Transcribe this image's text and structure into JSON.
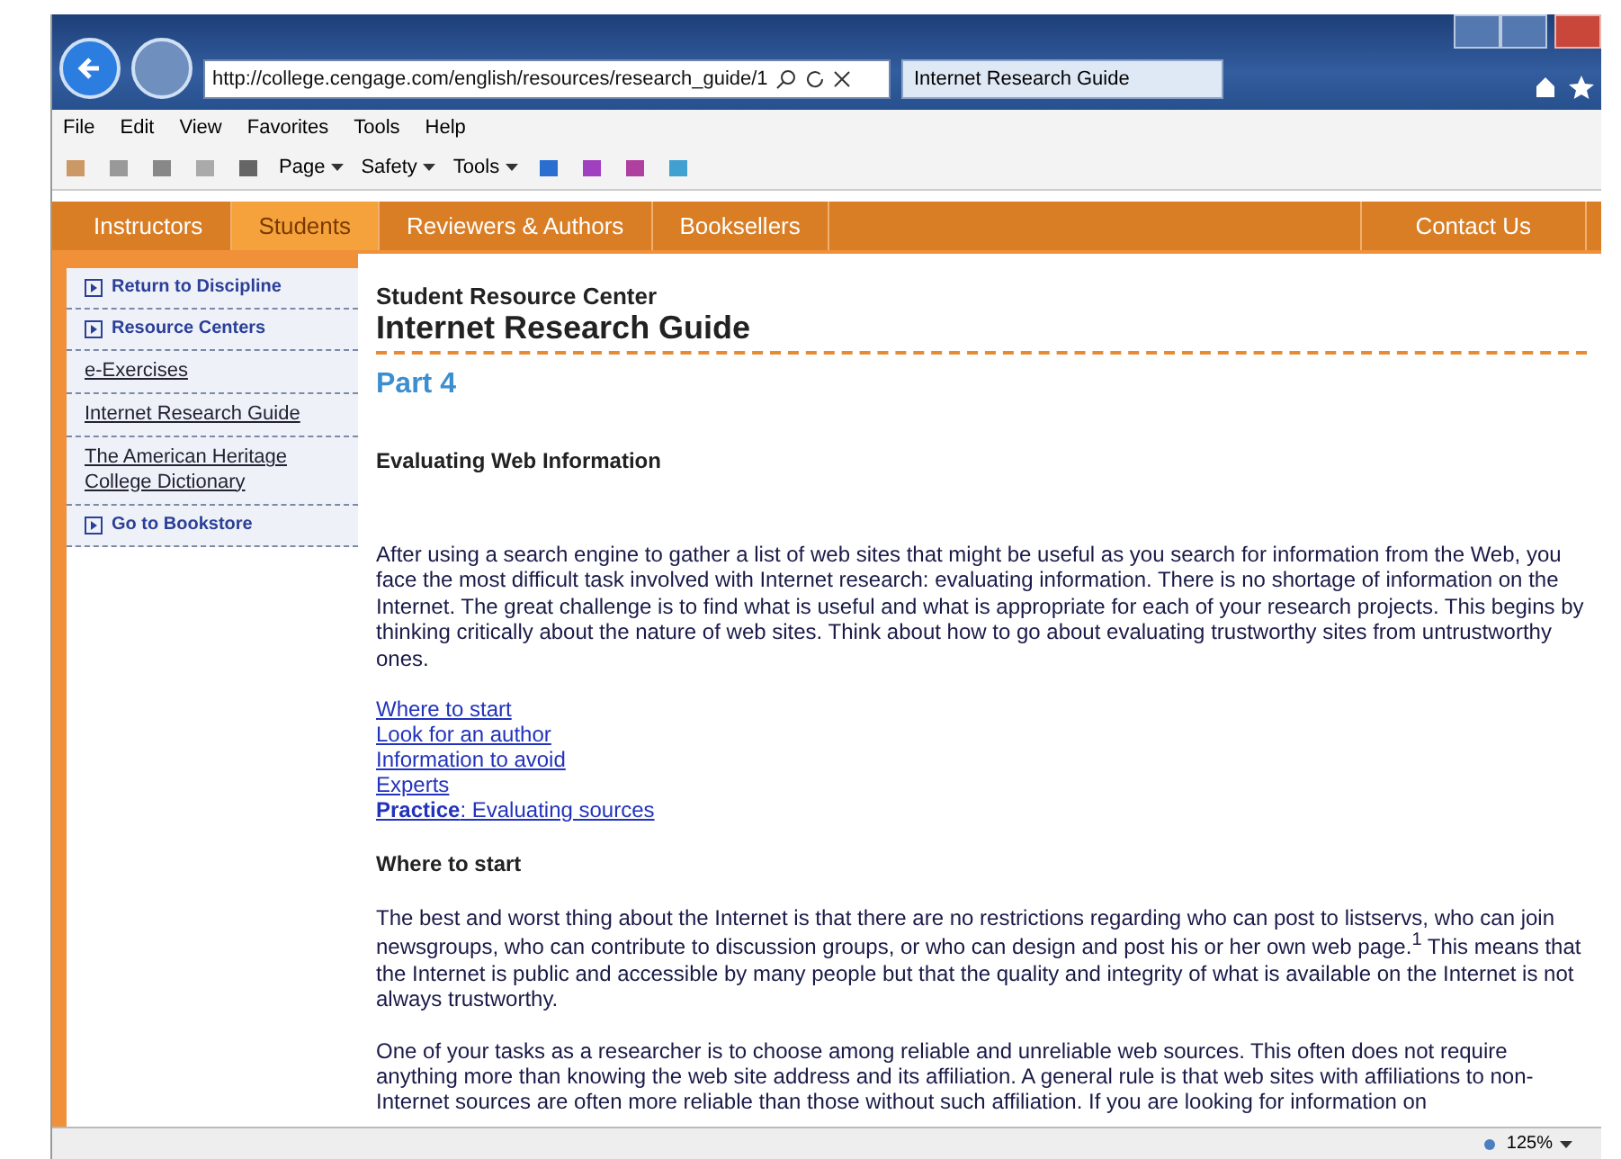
{
  "browser": {
    "address": "http://college.cengage.com/english/resources/research_guide/1",
    "tab_title": "Internet Research Guide",
    "menu": [
      "File",
      "Edit",
      "View",
      "Favorites",
      "Tools",
      "Help"
    ],
    "commands": [
      "Page",
      "Safety",
      "Tools"
    ],
    "zoom": "125%"
  },
  "nav": [
    {
      "label": "Instructors",
      "selected": false
    },
    {
      "label": "Students",
      "selected": true
    },
    {
      "label": "Reviewers & Authors",
      "selected": false
    },
    {
      "label": "Booksellers",
      "selected": false
    }
  ],
  "nav_right": "Contact Us",
  "sidebar": [
    {
      "label": "Return to Discipline",
      "kind": "section"
    },
    {
      "label": "Resource Centers",
      "kind": "section"
    },
    {
      "label": "e-Exercises",
      "kind": "link"
    },
    {
      "label": "Internet Research Guide",
      "kind": "link"
    },
    {
      "label": "The American Heritage College Dictionary",
      "kind": "link"
    },
    {
      "label": "Go to Bookstore",
      "kind": "section"
    }
  ],
  "content": {
    "kicker": "Student Resource Center",
    "title": "Internet Research Guide",
    "part": "Part 4",
    "heading": "Evaluating Web Information",
    "intro": "After using a search engine to gather a list of web sites that might be useful as you search for information from the Web, you face the most difficult task involved with Internet research: evaluating information. There is no shortage of information on the Internet. The great challenge is to find what is useful and what is appropriate for each of your research projects. This begins by thinking critically about the nature of web sites. Think about how to go about evaluating trustworthy sites from untrustworthy ones.",
    "links": [
      "Where to start",
      "Look for an author",
      "Information to avoid",
      "Experts",
      "**Practice**: Evaluating sources"
    ],
    "section_heading": "Where to start",
    "paragraphs": [
      "The best and worst thing about the Internet is that there are no restrictions regarding who can post to listservs, who can join newsgroups, who can contribute to discussion groups, or who can design and post his or her own web page.$^{1}$ This means that the Internet is public and accessible by many people but that the quality and integrity of what is available on the Internet is not always trustworthy.",
      "One of your tasks as a researcher is to choose among reliable and unreliable web sources. This often does not require anything more than knowing the web site address and its affiliation. A general rule is that web sites with affiliations to non-Internet sources are often more reliable than those without such affiliation. If you are looking for information on"
    ]
  }
}
